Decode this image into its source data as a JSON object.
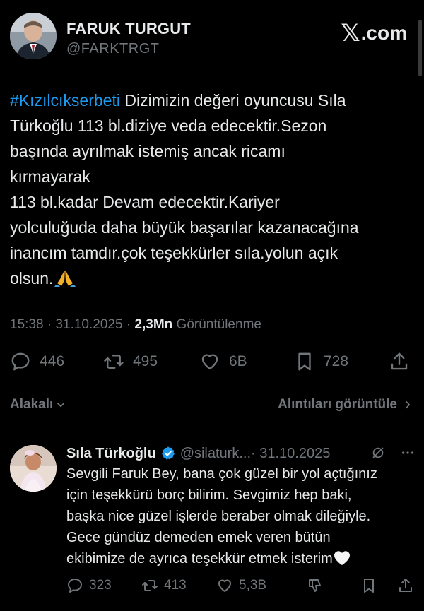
{
  "author": {
    "name": "FARUK TURGUT",
    "handle": "@FARKTRGT"
  },
  "brand": {
    "logo_text": ".com"
  },
  "tweet": {
    "hashtag": "#Kızılcıkserbeti",
    "text": " Dizimizin değeri oyuncusu Sıla\nTürkoğlu 113 bl.diziye veda edecektir.Sezon\nbaşında ayrılmak istemiş ancak ricamı\nkırmayarak\n113 bl.kadar Devam edecektir.Kariyer\nyolculuğuda daha büyük başarılar kazanacağına\ninancım tamdır.çok teşekkürler sıla.yolun açık\nolsun.",
    "emoji": "folded-hands-emoji"
  },
  "meta": {
    "time": "15:38 · 31.10.2025 · ",
    "views": "2,3Mn",
    "views_label": " Görüntülenme"
  },
  "actions": {
    "replies": "446",
    "reposts": "495",
    "likes": "6B",
    "bookmarks": "728"
  },
  "sort": {
    "left": "Alakalı",
    "right": "Alıntıları görüntüle"
  },
  "reply": {
    "name": "Sıla Türkoğlu",
    "handle": "@silaturk...",
    "date": " · 31.10.2025",
    "text": "Sevgili Faruk Bey, bana çok güzel bir yol açtığınız\niçin teşekkürü borç bilirim. Sevgimiz hep baki,\nbaşka nice güzel işlerde beraber olmak dileğiyle.\nGece gündüz demeden emek veren bütün\nekibimize de ayrıca teşekkür etmek isterim",
    "replies": "323",
    "reposts": "413",
    "likes": "5,3B"
  },
  "colors": {
    "background": "#000000",
    "text": "#e7e9ea",
    "muted": "#71767b",
    "accent": "#1d9bf0",
    "divider": "#2f3336"
  }
}
